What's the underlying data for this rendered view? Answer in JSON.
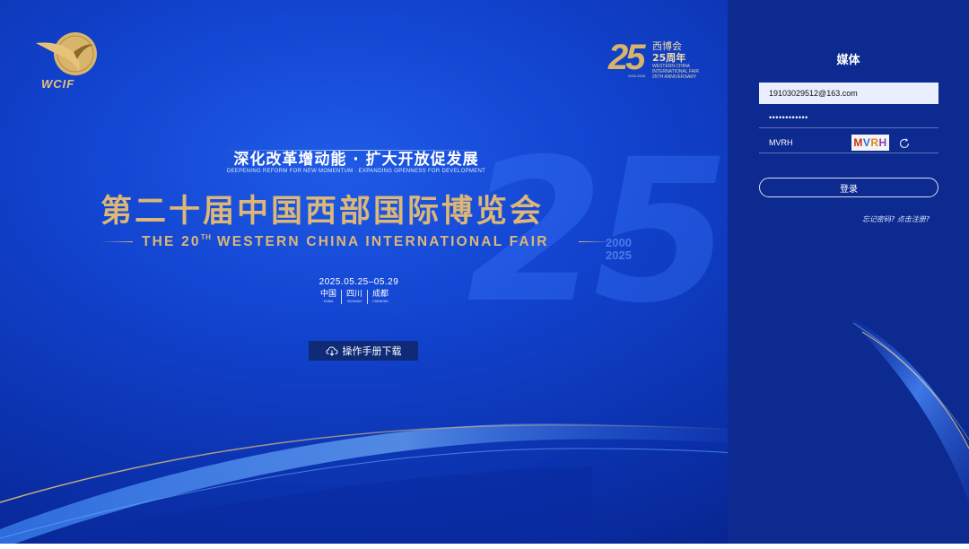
{
  "branding": {
    "logo_text": "WCIF",
    "anniversary": {
      "number": "25",
      "cn_name": "西博会",
      "cn_years": "25周年",
      "en_lines": [
        "WESTERN CHINA",
        "INTERNATIONAL FAIR",
        "25TH ANNIVERSARY"
      ],
      "range": "2000-2025"
    }
  },
  "hero": {
    "slogan_cn": "深化改革增动能 · 扩大开放促发展",
    "slogan_en": "DEEPENING REFORM FOR NEW MOMENTUM · EXPANDING OPENNESS FOR DEVELOPMENT",
    "title_cn": "第二十届中国西部国际博览会",
    "title_en_prefix": "THE 20",
    "title_en_sup": "TH",
    "title_en_rest": " WESTERN CHINA INTERNATIONAL FAIR",
    "date": "2025.05.25–05.29",
    "places": [
      {
        "cn": "中国",
        "en": "CHINA"
      },
      {
        "cn": "四川",
        "en": "SICHUAN"
      },
      {
        "cn": "成都",
        "en": "CHENGDU"
      }
    ],
    "watermark_number": "25",
    "watermark_year_start": "2000",
    "watermark_year_end": "2025",
    "manual_button": "操作手册下载"
  },
  "login": {
    "title": "媒体",
    "username_value": "19103029512@163.com",
    "password_value": "••••••••••••",
    "captcha_input_value": "MVRH",
    "captcha_chars": [
      "M",
      "V",
      "R",
      "H"
    ],
    "login_button": "登录",
    "forgot_link": "忘记密码?",
    "register_link": "点击注册?"
  },
  "colors": {
    "background_blue": "#1244d0",
    "panel_blue": "#0c2a8f",
    "gold": "#dcb777"
  }
}
